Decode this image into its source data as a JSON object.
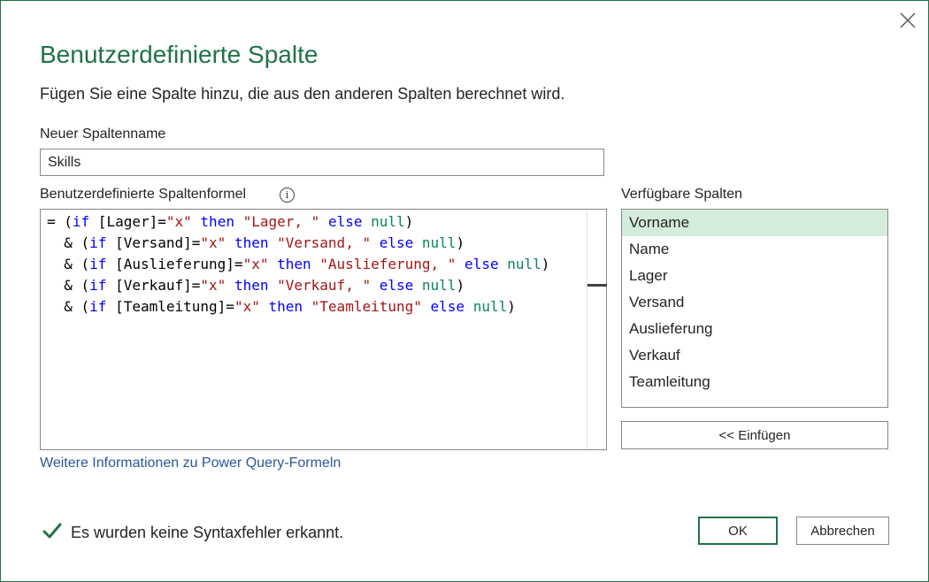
{
  "dialog": {
    "title": "Benutzerdefinierte Spalte",
    "subtitle": "Fügen Sie eine Spalte hinzu, die aus den anderen Spalten berechnet wird.",
    "close_icon": "close-icon",
    "accent_color": "#217346"
  },
  "column_name": {
    "label": "Neuer Spaltenname",
    "value": "Skills"
  },
  "formula": {
    "label": "Benutzerdefinierte Spaltenformel",
    "info_icon": "info-icon",
    "info_glyph": "i",
    "lines": [
      [
        [
          "p",
          "= ("
        ],
        [
          "k",
          "if"
        ],
        [
          "p",
          " [Lager]="
        ],
        [
          "s",
          "\"x\""
        ],
        [
          "p",
          " "
        ],
        [
          "k",
          "then"
        ],
        [
          "p",
          " "
        ],
        [
          "s",
          "\"Lager, \""
        ],
        [
          "p",
          " "
        ],
        [
          "k",
          "else"
        ],
        [
          "p",
          " "
        ],
        [
          "n",
          "null"
        ],
        [
          "p",
          ")"
        ]
      ],
      [
        [
          "p",
          "  & ("
        ],
        [
          "k",
          "if"
        ],
        [
          "p",
          " [Versand]="
        ],
        [
          "s",
          "\"x\""
        ],
        [
          "p",
          " "
        ],
        [
          "k",
          "then"
        ],
        [
          "p",
          " "
        ],
        [
          "s",
          "\"Versand, \""
        ],
        [
          "p",
          " "
        ],
        [
          "k",
          "else"
        ],
        [
          "p",
          " "
        ],
        [
          "n",
          "null"
        ],
        [
          "p",
          ")"
        ]
      ],
      [
        [
          "p",
          "  & ("
        ],
        [
          "k",
          "if"
        ],
        [
          "p",
          " [Auslieferung]="
        ],
        [
          "s",
          "\"x\""
        ],
        [
          "p",
          " "
        ],
        [
          "k",
          "then"
        ],
        [
          "p",
          " "
        ],
        [
          "s",
          "\"Auslieferung, \""
        ],
        [
          "p",
          " "
        ],
        [
          "k",
          "else"
        ],
        [
          "p",
          " "
        ],
        [
          "n",
          "null"
        ],
        [
          "p",
          ")"
        ]
      ],
      [
        [
          "p",
          "  & ("
        ],
        [
          "k",
          "if"
        ],
        [
          "p",
          " [Verkauf]="
        ],
        [
          "s",
          "\"x\""
        ],
        [
          "p",
          " "
        ],
        [
          "k",
          "then"
        ],
        [
          "p",
          " "
        ],
        [
          "s",
          "\"Verkauf, \""
        ],
        [
          "p",
          " "
        ],
        [
          "k",
          "else"
        ],
        [
          "p",
          " "
        ],
        [
          "n",
          "null"
        ],
        [
          "p",
          ")"
        ]
      ],
      [
        [
          "p",
          "  & ("
        ],
        [
          "k",
          "if"
        ],
        [
          "p",
          " [Teamleitung]="
        ],
        [
          "s",
          "\"x\""
        ],
        [
          "p",
          " "
        ],
        [
          "k",
          "then"
        ],
        [
          "p",
          " "
        ],
        [
          "s",
          "\"Teamleitung\""
        ],
        [
          "p",
          " "
        ],
        [
          "k",
          "else"
        ],
        [
          "p",
          " "
        ],
        [
          "n",
          "null"
        ],
        [
          "p",
          ")"
        ]
      ]
    ]
  },
  "available_columns": {
    "label": "Verfügbare Spalten",
    "items": [
      "Vorname",
      "Name",
      "Lager",
      "Versand",
      "Auslieferung",
      "Verkauf",
      "Teamleitung"
    ],
    "selected": "Vorname",
    "selected_color": "#d3ecdb"
  },
  "buttons": {
    "insert_label": "<< Einfügen",
    "ok_label": "OK",
    "cancel_label": "Abbrechen"
  },
  "help_link": "Weitere Informationen zu Power Query-Formeln",
  "status": {
    "icon": "checkmark-icon",
    "text": "Es wurden keine Syntaxfehler erkannt."
  }
}
